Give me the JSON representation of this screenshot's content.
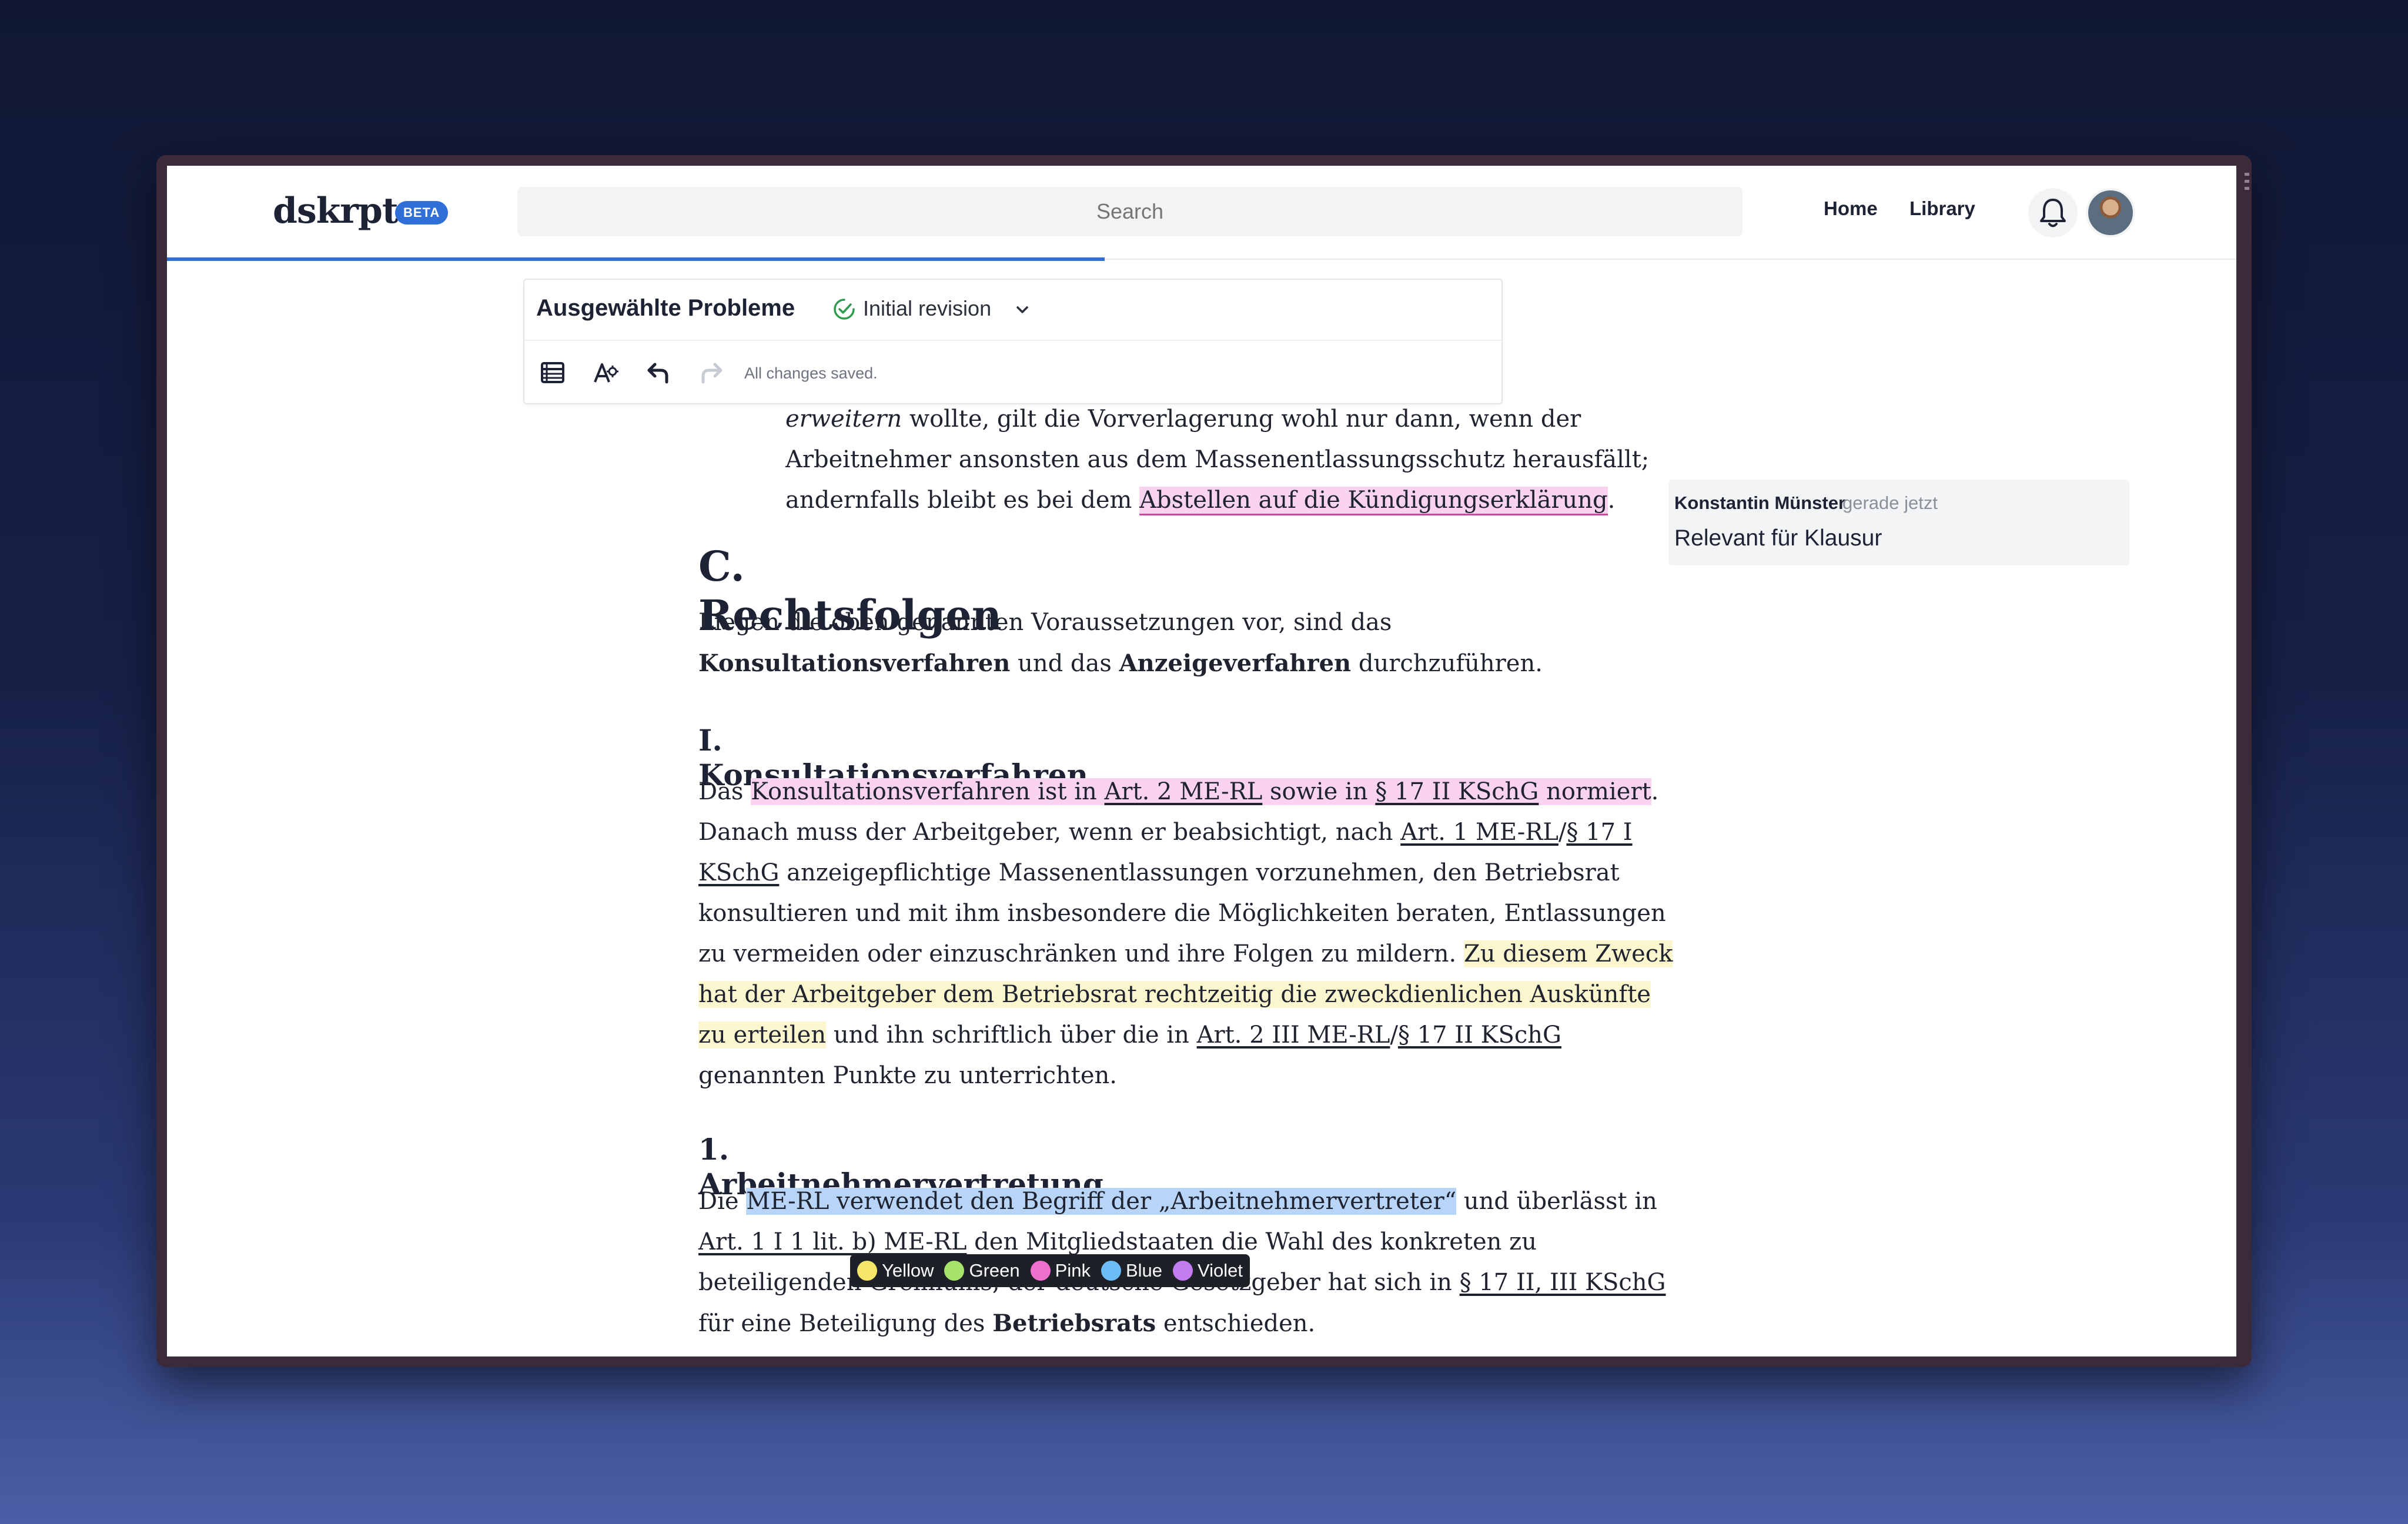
{
  "app": {
    "logo": "dskrpt",
    "badge": "BETA",
    "search_placeholder": "Search",
    "nav": {
      "home": "Home",
      "library": "Library"
    }
  },
  "editor": {
    "doc_title": "Ausgewählte Probleme",
    "revision": "Initial revision",
    "save_status": "All changes saved."
  },
  "document": {
    "intro": {
      "line1_italic": "erweitern",
      "line1_rest": " wollte, gilt die Vorverlagerung wohl nur dann, wenn der",
      "line2": "Arbeitnehmer ansonsten aus dem Massenentlassungsschutz herausfällt;",
      "line3_pre": "andernfalls bleibt es bei dem ",
      "line3_highlight": "Abstellen auf die Kündigungserklärung",
      "line3_post": "."
    },
    "section_c": {
      "title": "C. Rechtsfolgen",
      "p1_line1": "Liegen die oben genannten Voraussetzungen vor, sind das",
      "p1_bold1": "Konsultationsverfahren",
      "p1_mid": " und das ",
      "p1_bold2": "Anzeigeverfahren",
      "p1_end": " durchzuführen."
    },
    "section_i": {
      "title": "I. Konsultationsverfahren",
      "l1_pre": "Das ",
      "l1_hl_a": "Konsultationsverfahren ist in ",
      "l1_link1": "Art. 2 ME-RL",
      "l1_hl_b": " sowie in ",
      "l1_link2": "§ 17 II KSchG",
      "l1_hl_c": " normiert",
      "l1_post": ".",
      "l2_pre": "Danach muss der Arbeitgeber, wenn er beabsichtigt, nach ",
      "l2_link1": "Art. 1 ME-RL",
      "l2_sep": "/",
      "l2_link2": "§ 17 I ",
      "l3_link": "KSchG",
      "l3_rest": " anzeigepflichtige Massenentlassungen vorzunehmen, den Betriebsrat",
      "l4": "konsultieren und mit ihm insbesondere die Möglichkeiten beraten, Entlassungen",
      "l5_pre": "zu vermeiden oder einzuschränken und ihre Folgen zu mildern. ",
      "l5_hl": "Zu diesem Zweck",
      "l6_hl": "hat der Arbeitgeber dem Betriebsrat rechtzeitig die zweckdienlichen Auskünfte",
      "l7_hl": "zu erteilen",
      "l7_mid": " und ihn schriftlich über die in ",
      "l7_link1": "Art. 2 III ME-RL",
      "l7_sep": "/",
      "l7_link2": "§ 17 II KSchG",
      "l8": "genannten Punkte zu unterrichten."
    },
    "section_1": {
      "title": "1. Arbeitnehmervertretung",
      "l1_pre": "Die ",
      "l1_hl": "ME-RL verwendet den Begriff der „Arbeitnehmervertreter“",
      "l1_post": " und überlässt in",
      "l2_link": "Art. 1 I 1 lit. b) ME-RL",
      "l2_rest": " den Mitgliedstaaten die Wahl des konkreten zu",
      "l3_pre": "beteiligenden Gremiums; der deutsche Gesetzgeber hat sich in ",
      "l3_link": "§ 17 II, III KSchG",
      "l4_pre": "für eine Beteiligung des ",
      "l4_bold": "Betriebsrats",
      "l4_post": " entschieden."
    }
  },
  "comment": {
    "author": "Konstantin Münster",
    "time": "gerade jetzt",
    "text": "Relevant für Klausur"
  },
  "highlight_picker": [
    {
      "label": "Yellow",
      "color": "#f5e66a"
    },
    {
      "label": "Green",
      "color": "#a6e36a"
    },
    {
      "label": "Pink",
      "color": "#ef6fcf"
    },
    {
      "label": "Blue",
      "color": "#6cbcf5"
    },
    {
      "label": "Violet",
      "color": "#c27cf0"
    }
  ],
  "colors": {
    "accent": "#2f6fd6",
    "highlight_pink": "#f9d3ef",
    "highlight_yellow": "#fbf6cd",
    "highlight_blue": "#b8d5f7"
  }
}
